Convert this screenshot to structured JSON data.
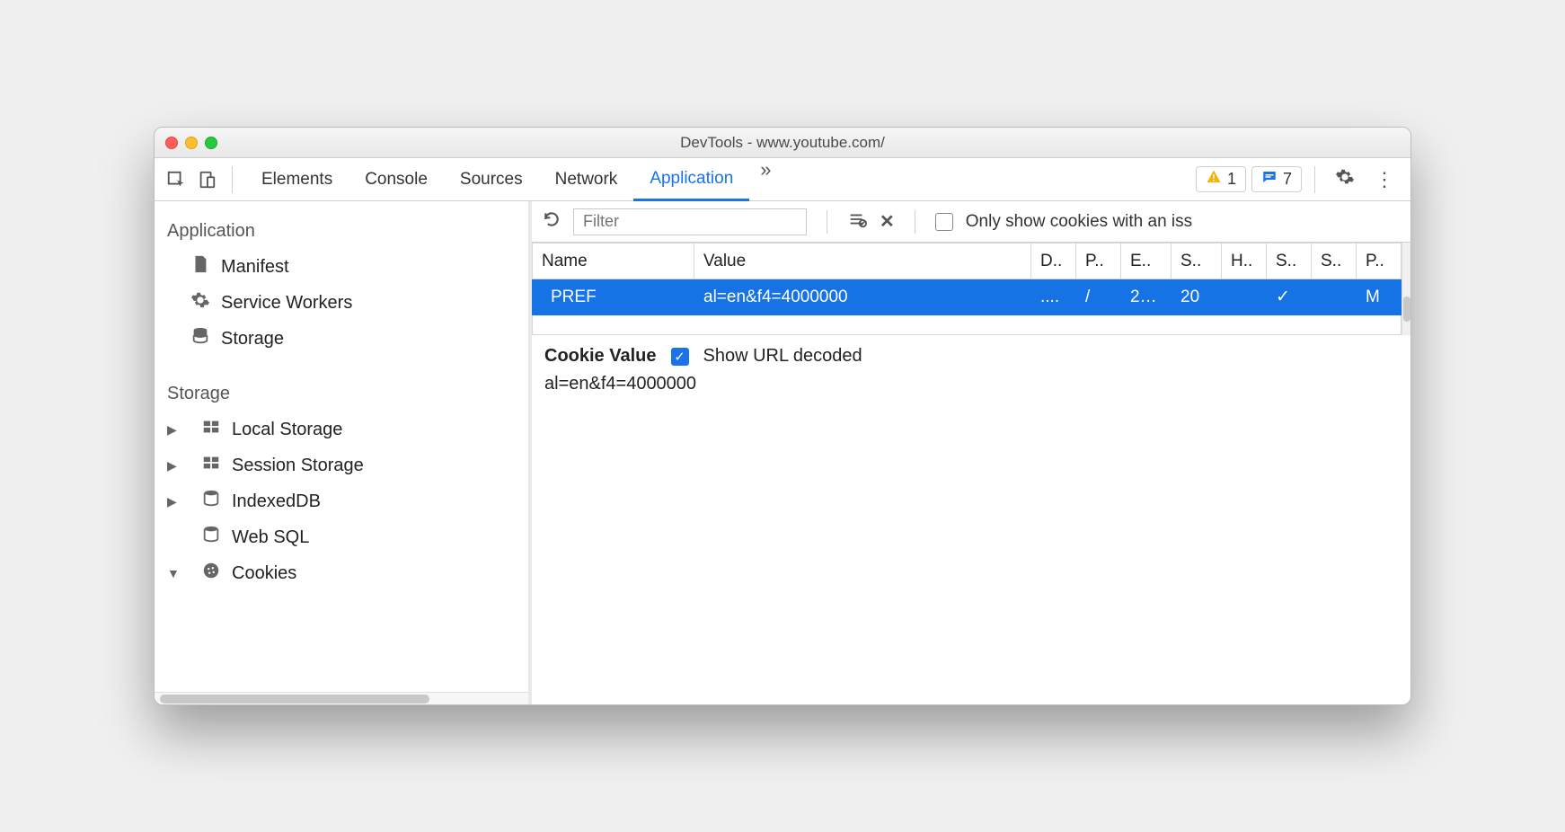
{
  "window": {
    "title": "DevTools - www.youtube.com/"
  },
  "toolbar": {
    "tabs": [
      "Elements",
      "Console",
      "Sources",
      "Network",
      "Application"
    ],
    "active_tab": "Application",
    "warning_count": "1",
    "message_count": "7"
  },
  "sidebar": {
    "sections": [
      {
        "title": "Application",
        "items": [
          {
            "icon": "file-icon",
            "label": "Manifest",
            "expandable": false
          },
          {
            "icon": "gear-icon",
            "label": "Service Workers",
            "expandable": false
          },
          {
            "icon": "db-icon",
            "label": "Storage",
            "expandable": false
          }
        ]
      },
      {
        "title": "Storage",
        "items": [
          {
            "icon": "table-icon",
            "label": "Local Storage",
            "expandable": true,
            "expanded": false
          },
          {
            "icon": "table-icon",
            "label": "Session Storage",
            "expandable": true,
            "expanded": false
          },
          {
            "icon": "db-icon",
            "label": "IndexedDB",
            "expandable": true,
            "expanded": false
          },
          {
            "icon": "db-icon",
            "label": "Web SQL",
            "expandable": false
          },
          {
            "icon": "cookie-icon",
            "label": "Cookies",
            "expandable": true,
            "expanded": true
          }
        ]
      }
    ]
  },
  "main": {
    "filter_placeholder": "Filter",
    "only_issue_label": "Only show cookies with an iss",
    "columns": [
      "Name",
      "Value",
      "D..",
      "P..",
      "E..",
      "S..",
      "H..",
      "S..",
      "S..",
      "P.."
    ],
    "row": {
      "name": "PREF",
      "value": "al=en&f4=4000000",
      "domain": "....",
      "path": "/",
      "expires": "2…",
      "size": "20",
      "httponly": "",
      "secure": "✓",
      "samesite": "",
      "priority": "M"
    },
    "cookie_panel": {
      "heading": "Cookie Value",
      "decode_label": "Show URL decoded",
      "decode_checked": true,
      "value": "al=en&f4=4000000"
    }
  }
}
